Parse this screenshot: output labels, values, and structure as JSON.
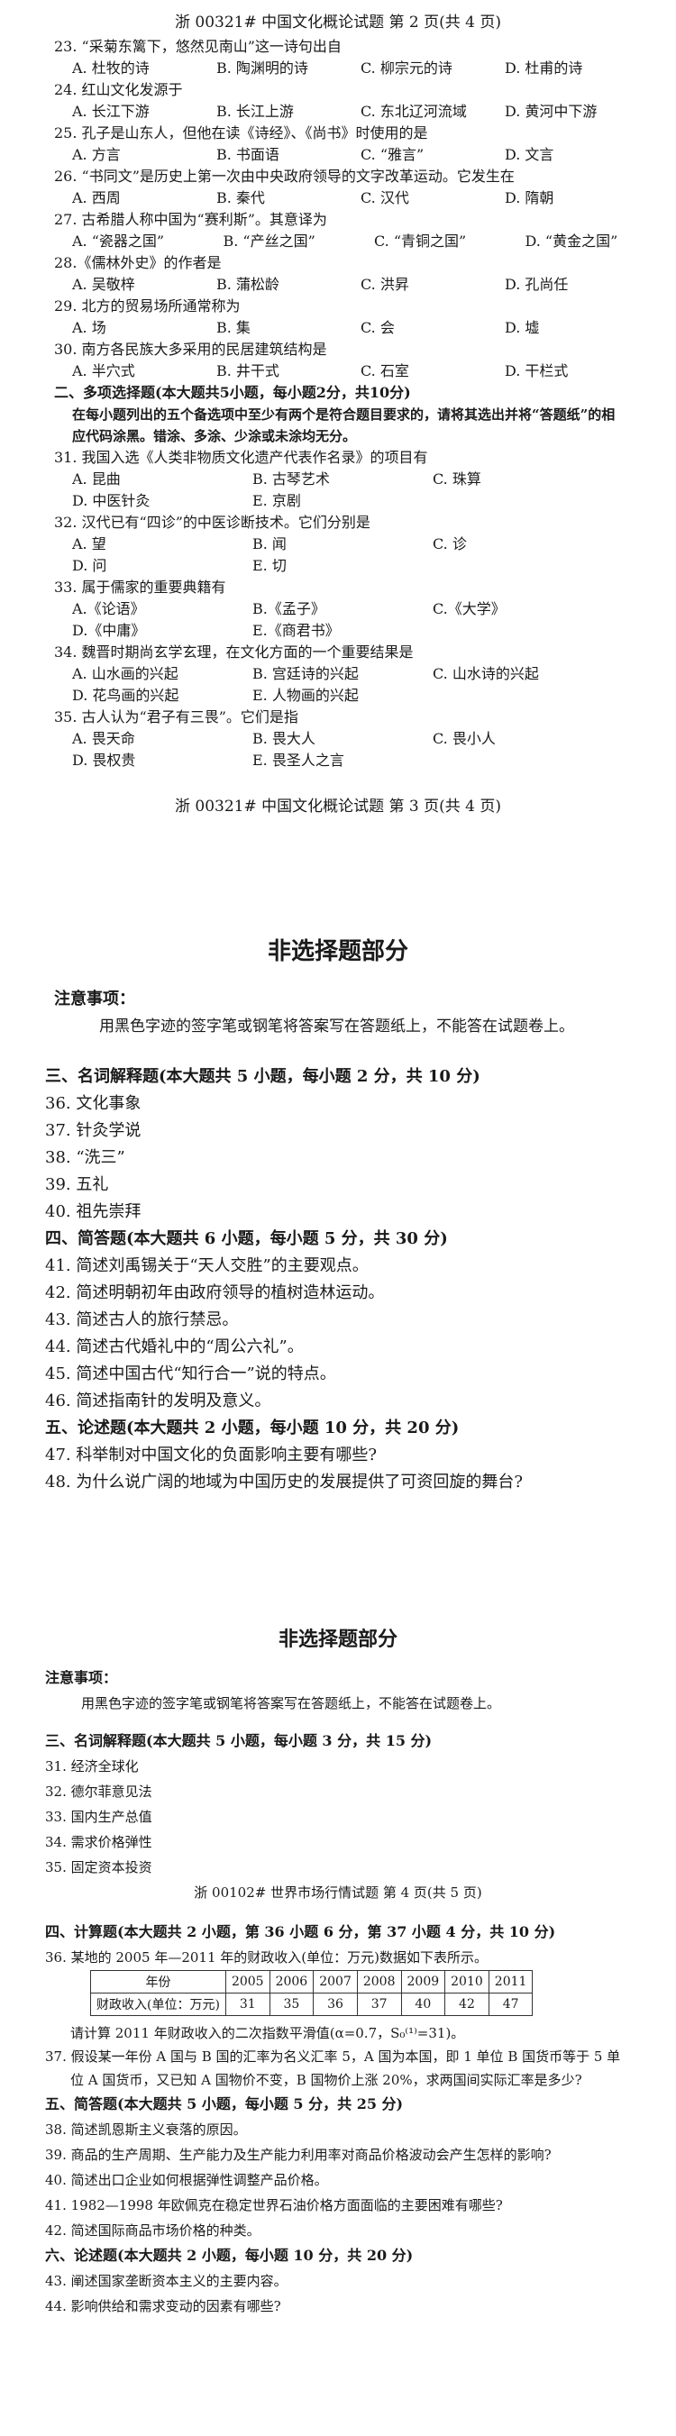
{
  "page1": {
    "questions": [
      {
        "q": "23. “采菊东篱下，悠然见南山”这一诗句出自",
        "opts": [
          "A. 杜牧的诗",
          "B. 陶渊明的诗",
          "C. 柳宗元的诗",
          "D. 杜甫的诗"
        ]
      },
      {
        "q": "24. 红山文化发源于",
        "opts": [
          "A. 长江下游",
          "B. 长江上游",
          "C. 东北辽河流域",
          "D. 黄河中下游"
        ]
      },
      {
        "q": "25. 孔子是山东人，但他在读《诗经》、《尚书》时使用的是",
        "opts": [
          "A. 方言",
          "B. 书面语",
          "C. “雅言”",
          "D. 文言"
        ]
      },
      {
        "q": "26. “书同文”是历史上第一次由中央政府领导的文字改革运动。它发生在",
        "opts": [
          "A. 西周",
          "B. 秦代",
          "C. 汉代",
          "D. 隋朝"
        ]
      },
      {
        "q": "27. 古希腊人称中国为“赛利斯”。其意译为",
        "opts": [
          "A. “瓷器之国”",
          "B. “产丝之国”",
          "C. “青铜之国”",
          "D. “黄金之国”"
        ],
        "wide": true
      },
      {
        "q": "28.《儒林外史》的作者是",
        "opts": [
          "A. 吴敬梓",
          "B. 蒲松龄",
          "C. 洪昇",
          "D. 孔尚任"
        ]
      },
      {
        "q": "29. 北方的贸易场所通常称为",
        "opts": [
          "A. 场",
          "B. 集",
          "C. 会",
          "D. 墟"
        ]
      },
      {
        "q": "30. 南方各民族大多采用的民居建筑结构是",
        "opts": [
          "A. 半穴式",
          "B. 井干式",
          "C. 石室",
          "D. 干栏式"
        ]
      }
    ],
    "section2_title": "二、多项选择题(本大题共5小题，每小题2分，共10分)",
    "section2_note": "在每小题列出的五个备选项中至少有两个是符合题目要求的，请将其选出并将“答题纸”的相应代码涂黑。错涂、多涂、少涂或未涂均无分。",
    "multi": [
      {
        "q": "31. 我国入选《人类非物质文化遗产代表作名录》的项目有",
        "rows": [
          [
            "A. 昆曲",
            "B. 古琴艺术",
            "C. 珠算"
          ],
          [
            "D. 中医针灸",
            "E. 京剧"
          ]
        ]
      },
      {
        "q": "32. 汉代已有“四诊”的中医诊断技术。它们分别是",
        "rows": [
          [
            "A. 望",
            "B. 闻",
            "C. 诊"
          ],
          [
            "D. 问",
            "E. 切"
          ]
        ]
      },
      {
        "q": "33. 属于儒家的重要典籍有",
        "rows": [
          [
            "A.《论语》",
            "B.《孟子》",
            "C.《大学》"
          ],
          [
            "D.《中庸》",
            "E.《商君书》"
          ]
        ]
      },
      {
        "q": "34. 魏晋时期尚玄学玄理，在文化方面的一个重要结果是",
        "rows": [
          [
            "A. 山水画的兴起",
            "B. 宫廷诗的兴起",
            "C. 山水诗的兴起"
          ],
          [
            "D. 花鸟画的兴起",
            "E. 人物画的兴起"
          ]
        ]
      },
      {
        "q": "35. 古人认为“君子有三畏”。它们是指",
        "rows": [
          [
            "A. 畏天命",
            "B. 畏大人",
            "C. 畏小人"
          ],
          [
            "D. 畏权贵",
            "E. 畏圣人之言"
          ]
        ]
      }
    ],
    "footer": "浙 00321# 中国文化概论试题 第 3 页(共 4 页)"
  },
  "header1": "浙 00321# 中国文化概论试题 第 2 页(共 4 页)",
  "page2": {
    "title": "非选择题部分",
    "notice_label": "注意事项：",
    "notice_text": "用黑色字迹的签字笔或钢笔将答案写在答题纸上，不能答在试题卷上。",
    "sec3": "三、名词解释题(本大题共 5 小题，每小题 2 分，共 10 分)",
    "sec3_items": [
      "36.  文化事象",
      "37.  针灸学说",
      "38.  “洗三”",
      "39.  五礼",
      "40.  祖先崇拜"
    ],
    "sec4": "四、简答题(本大题共 6 小题，每小题 5 分，共 30 分)",
    "sec4_items": [
      "41.  简述刘禹锡关于“天人交胜”的主要观点。",
      "42.  简述明朝初年由政府领导的植树造林运动。",
      "43.  简述古人的旅行禁忌。",
      "44.  简述古代婚礼中的“周公六礼”。",
      "45.  简述中国古代“知行合一”说的特点。",
      "46.  简述指南针的发明及意义。"
    ],
    "sec5": "五、论述题(本大题共 2 小题，每小题 10 分，共 20 分)",
    "sec5_items": [
      "47.  科举制对中国文化的负面影响主要有哪些?",
      "48.  为什么说广阔的地域为中国历史的发展提供了可资回旋的舞台?"
    ]
  },
  "page3": {
    "title": "非选择题部分",
    "notice_label": "注意事项：",
    "notice_text": "用黑色字迹的签字笔或钢笔将答案写在答题纸上，不能答在试题卷上。",
    "sec3": "三、名词解释题(本大题共 5 小题，每小题 3 分，共 15 分)",
    "sec3_items": [
      "31. 经济全球化",
      "32. 德尔菲意见法",
      "33. 国内生产总值",
      "34. 需求价格弹性",
      "35. 固定资本投资"
    ],
    "header": "浙 00102# 世界市场行情试题 第 4 页(共 5 页)",
    "sec4": "四、计算题(本大题共 2 小题，第 36 小题 6 分，第 37 小题 4 分，共 10 分)",
    "q36": "36. 某地的 2005 年—2011 年的财政收入(单位：万元)数据如下表所示。",
    "table": {
      "row1": [
        "年份",
        "2005",
        "2006",
        "2007",
        "2008",
        "2009",
        "2010",
        "2011"
      ],
      "row2": [
        "财政收入(单位：万元)",
        "31",
        "35",
        "36",
        "37",
        "40",
        "42",
        "47"
      ]
    },
    "q36_ask": "请计算 2011 年财政收入的二次指数平滑值(α=0.7，S₀⁽¹⁾=31)。",
    "q37": "37. 假设某一年份 A 国与 B 国的汇率为名义汇率 5，A 国为本国，即 1 单位 B 国货币等于 5 单",
    "q37b": "位 A 国货币，又已知 A 国物价不变，B 国物价上涨 20%，求两国间实际汇率是多少?",
    "sec5": "五、简答题(本大题共 5 小题，每小题 5 分，共 25 分)",
    "sec5_items": [
      "38. 简述凯恩斯主义衰落的原因。",
      "39. 商品的生产周期、生产能力及生产能力利用率对商品价格波动会产生怎样的影响?",
      "40. 简述出口企业如何根据弹性调整产品价格。",
      "41. 1982—1998 年欧佩克在稳定世界石油价格方面面临的主要困难有哪些?",
      "42. 简述国际商品市场价格的种类。"
    ],
    "sec6": "六、论述题(本大题共 2 小题，每小题 10 分，共 20 分)",
    "sec6_items": [
      "43. 阐述国家垄断资本主义的主要内容。",
      "44. 影响供给和需求变动的因素有哪些?"
    ]
  }
}
